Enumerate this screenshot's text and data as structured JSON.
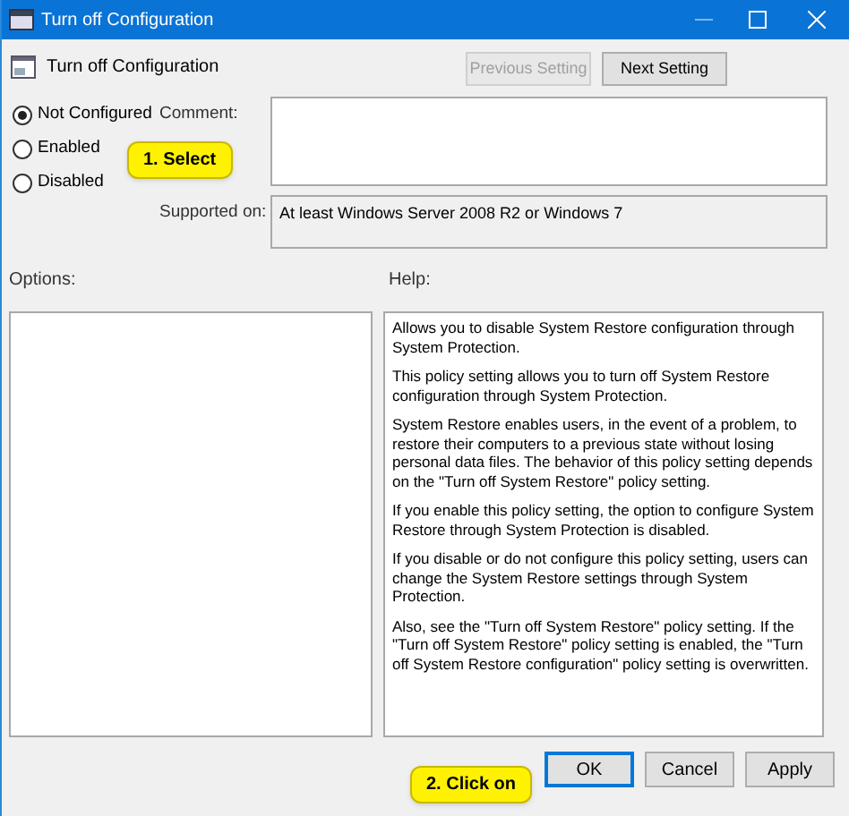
{
  "window": {
    "title": "Turn off Configuration"
  },
  "header": {
    "title": "Turn off Configuration",
    "buttons": [
      {
        "label": "Previous Setting",
        "disabled": true
      },
      {
        "label": "Next Setting",
        "disabled": false
      }
    ]
  },
  "radios": [
    {
      "label": "Not Configured",
      "selected": true
    },
    {
      "label": "Enabled",
      "selected": false
    },
    {
      "label": "Disabled",
      "selected": false
    }
  ],
  "comment": {
    "label": "Comment:"
  },
  "supported_on": {
    "label": "Supported on:",
    "value": "At least Windows Server 2008 R2 or Windows 7"
  },
  "options": {
    "label": "Options:"
  },
  "help": {
    "label": "Help:",
    "paragraphs": [
      "Allows you to disable System Restore configuration through System Protection.",
      "This policy setting allows you to turn off System Restore configuration through System Protection.",
      "System Restore enables users, in the event of a problem, to restore their computers to a previous state without losing personal data files. The behavior of this policy setting depends on the \"Turn off System Restore\" policy setting.",
      "If you enable this policy setting, the option to configure System Restore through System Protection is disabled.",
      "If you disable or do not configure this policy setting, users can change the System Restore settings through System Protection.",
      "Also, see the \"Turn off System Restore\" policy setting. If the \"Turn off System Restore\" policy setting is enabled, the \"Turn off System Restore configuration\" policy setting is overwritten."
    ]
  },
  "callouts": [
    {
      "text": "1. Select"
    },
    {
      "text": "2. Click on"
    }
  ],
  "footer_buttons": [
    {
      "label": "OK",
      "selected": true
    },
    {
      "label": "Cancel",
      "selected": false
    },
    {
      "label": "Apply",
      "selected": false
    }
  ]
}
